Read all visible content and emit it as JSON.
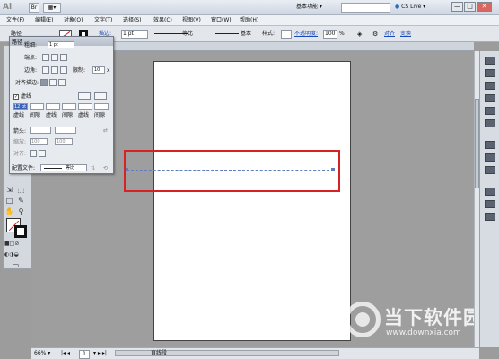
{
  "titlebar": {
    "logo": "Ai",
    "workspace": "基本功能",
    "cslive": "CS Live",
    "minimize": "—",
    "restore": "□",
    "close": "✕"
  },
  "menu": [
    "文件(F)",
    "编辑(E)",
    "对象(O)",
    "文字(T)",
    "选择(S)",
    "效果(C)",
    "视图(V)",
    "窗口(W)",
    "帮助(H)"
  ],
  "control": {
    "path_label": "路径",
    "stroke_label": "描边:",
    "stroke_value": "1 pt",
    "dash_style": "等比",
    "brush": "基本",
    "style_label": "样式:",
    "opacity_label": "不透明度:",
    "opacity_value": "100",
    "opacity_unit": "%",
    "align_link": "对齐",
    "transform_link": "变换"
  },
  "stroke_panel": {
    "weight_label": "粗细:",
    "weight_value": "1 pt",
    "cap_label": "端点:",
    "corner_label": "边角:",
    "limit_label": "限制:",
    "limit_value": "10",
    "limit_unit": "x",
    "align_label": "对齐描边:",
    "dashed_label": "虚线",
    "dash_values": [
      "12 pt",
      "",
      "",
      "",
      "",
      ""
    ],
    "dash_labels": [
      "虚线",
      "间隙",
      "虚线",
      "间隙",
      "虚线",
      "间隙"
    ],
    "arrow_label": "箭头:",
    "scale_label": "缩放:",
    "scale_value1": "100",
    "scale_value2": "100",
    "align_arrow_label": "对齐:",
    "profile_label": "配置文件:",
    "profile_value": "等比"
  },
  "status": {
    "zoom": "66%",
    "page": "1",
    "tool": "直线段"
  },
  "watermark": {
    "title": "当下软件园",
    "url": "www.downxia.com"
  }
}
